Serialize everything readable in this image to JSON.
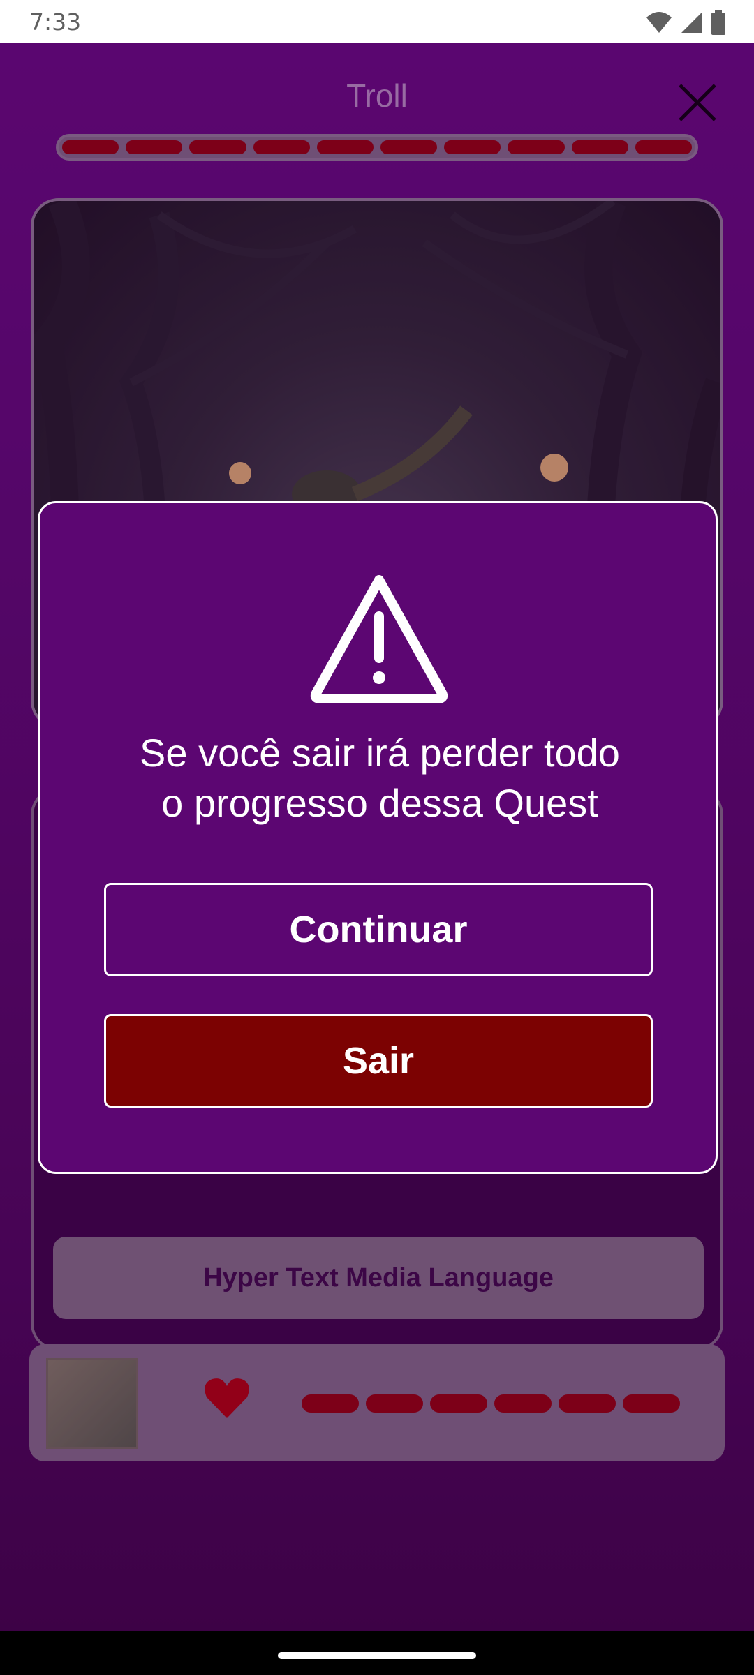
{
  "status_bar": {
    "time": "7:33"
  },
  "screen": {
    "title": "Troll"
  },
  "question_card": {
    "answer_label": "Hyper Text Media Language"
  },
  "dialog": {
    "message_line1": "Se você sair irá perder todo",
    "message_line2": "o progresso dessa Quest",
    "continue_label": "Continuar",
    "exit_label": "Sair"
  },
  "player": {
    "hp_segments": 6
  },
  "quest_progress": {
    "segments": 10
  },
  "colors": {
    "primary": "#6b0a87",
    "danger": "#7c0202",
    "hp": "#a00000"
  },
  "icons": [
    "close-icon",
    "warning-icon",
    "heart-icon",
    "wifi-icon",
    "signal-icon",
    "battery-icon"
  ]
}
